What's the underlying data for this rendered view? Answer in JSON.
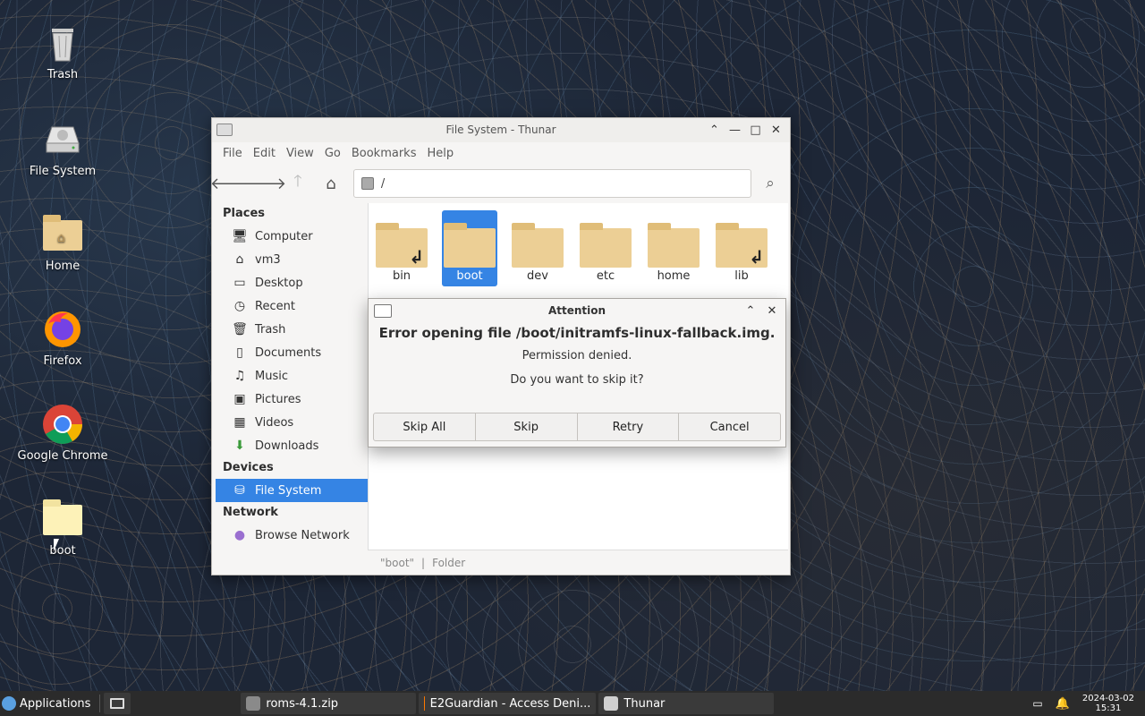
{
  "desktop": {
    "icons": [
      {
        "label": "Trash",
        "icon": "trash-icon"
      },
      {
        "label": "File System",
        "icon": "drive-icon"
      },
      {
        "label": "Home",
        "icon": "home-folder-icon"
      },
      {
        "label": "Firefox",
        "icon": "firefox-icon"
      },
      {
        "label": "Google Chrome",
        "icon": "chrome-icon"
      },
      {
        "label": "boot",
        "icon": "folder-icon"
      }
    ]
  },
  "window": {
    "title": "File System - Thunar",
    "menu": [
      "File",
      "Edit",
      "View",
      "Go",
      "Bookmarks",
      "Help"
    ],
    "location": "/",
    "sidebar": {
      "places_header": "Places",
      "places": [
        "Computer",
        "vm3",
        "Desktop",
        "Recent",
        "Trash",
        "Documents",
        "Music",
        "Pictures",
        "Videos",
        "Downloads"
      ],
      "devices_header": "Devices",
      "devices": [
        "File System"
      ],
      "network_header": "Network",
      "network": [
        "Browse Network"
      ]
    },
    "files": [
      {
        "name": "bin",
        "symlink": true
      },
      {
        "name": "boot",
        "selected": true
      },
      {
        "name": "dev"
      },
      {
        "name": "etc"
      },
      {
        "name": "home"
      },
      {
        "name": "lib",
        "symlink": true
      }
    ],
    "status": {
      "name": "\"boot\"",
      "separator": "|",
      "type": "Folder"
    }
  },
  "dialog": {
    "title": "Attention",
    "heading": "Error opening file /boot/initramfs-linux-fallback.img.",
    "message": "Permission denied.",
    "question": "Do you want to skip it?",
    "buttons": [
      "Skip All",
      "Skip",
      "Retry",
      "Cancel"
    ]
  },
  "taskbar": {
    "apps_label": "Applications",
    "tasks": [
      {
        "label": "roms-4.1.zip"
      },
      {
        "label": "E2Guardian - Access Deni..."
      },
      {
        "label": "Thunar"
      }
    ],
    "date": "2024-03-02",
    "time": "15:31"
  },
  "colors": {
    "selection": "#3584e4",
    "folder": "#eccf95",
    "taskbar": "#2b2b2b"
  }
}
